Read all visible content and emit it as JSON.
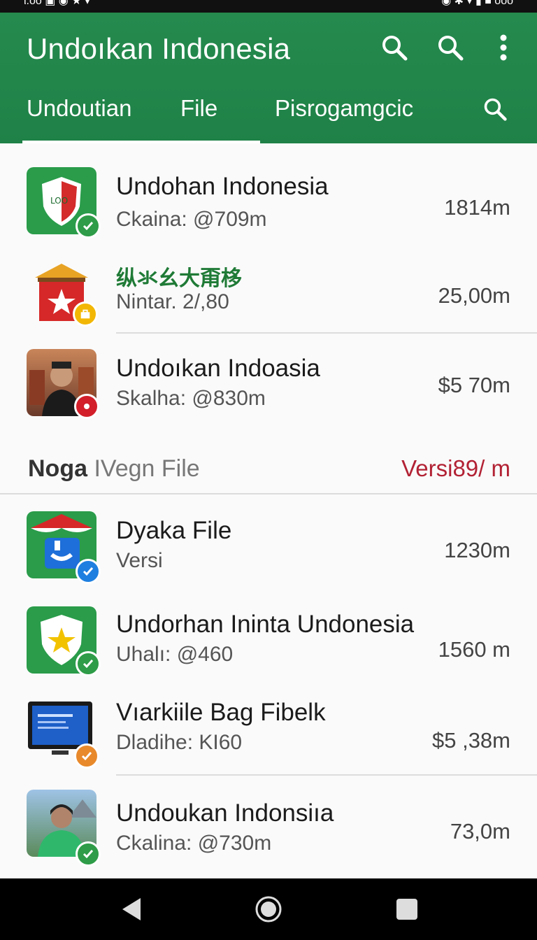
{
  "status_bar": {
    "left": "ι.οο ▣ ◉ ★ ▾",
    "right": "◉ ✱ ▾ ▮ ■ ooo"
  },
  "app_bar": {
    "title": "Undoıkan Indonesia",
    "tabs": [
      {
        "label": "Undoutian",
        "selected": true
      },
      {
        "label": "File",
        "selected": true
      },
      {
        "label": "Pisrogamgcic",
        "selected": false
      }
    ],
    "icons": [
      "search-icon",
      "search-icon",
      "more-vert-icon",
      "search-icon"
    ]
  },
  "list": {
    "items": [
      {
        "title": "Undohan Indonesia",
        "subtitle": "Ckaina: @709m",
        "size": "1814m",
        "icon": "shield-app-icon",
        "badge": "check",
        "badge_color": "#2e9c48"
      },
      {
        "title": "纵氺幺大甭栘",
        "subtitle": "Nintar. 2/,80",
        "size": "25,00m",
        "icon": "star-house-icon",
        "badge": "briefcase",
        "badge_color": "#f2b705"
      },
      {
        "title": "Undoıkan Indoasia",
        "subtitle": "Skalha: @830m",
        "size": "$5 70m",
        "icon": "portrait-icon",
        "badge": "dot",
        "badge_color": "#d21f2a"
      },
      {
        "title": "Dyaka File",
        "subtitle": "Versi",
        "size": "1230m",
        "icon": "tent-app-icon",
        "badge": "check",
        "badge_color": "#1e7fe0"
      },
      {
        "title": "Undorhan Ininta Undonesia",
        "subtitle": "Uhalı: @460",
        "size": "1560 m",
        "icon": "star-shield-icon",
        "badge": "check",
        "badge_color": "#2e9c48"
      },
      {
        "title": "Vıarkiile Bag Fibelk",
        "subtitle": "Dladihe: KI60",
        "size": "$5 ,38m",
        "icon": "monitor-icon",
        "badge": "check",
        "badge_color": "#e8892b"
      },
      {
        "title": "Undoukan Indonsiıa",
        "subtitle": "Ckalina: @730m",
        "size": "73,0m",
        "icon": "worker-photo-icon",
        "badge": "check",
        "badge_color": "#2e9c48"
      }
    ],
    "section": {
      "bold": "Noga",
      "light": "IVegn File",
      "right": "Versi89/ m"
    }
  },
  "nav_bar": {
    "buttons": [
      "back-icon",
      "home-icon",
      "recents-icon"
    ]
  },
  "colors": {
    "primary": "#238a4c",
    "accent_red": "#b22234",
    "nav": "#000000"
  }
}
